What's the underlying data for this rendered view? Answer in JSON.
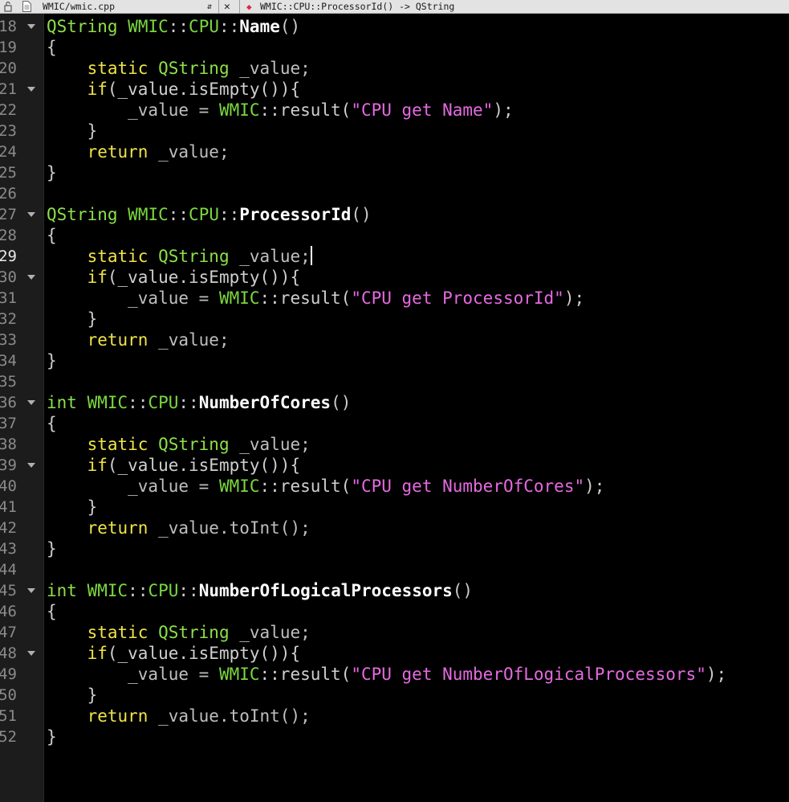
{
  "toolbar": {
    "file_name": "WMIC/wmic.cpp",
    "file_sort_glyph": "⇵",
    "close_glyph": "✕",
    "symbol_glyph": "◆",
    "symbol_name": "WMIC::CPU::ProcessorId() -> QString"
  },
  "editor": {
    "current_line": 29,
    "fold_lines": [
      18,
      21,
      27,
      30,
      36,
      39,
      45,
      48
    ],
    "lines": [
      {
        "n": "18",
        "t": [
          [
            "QString",
            "ty"
          ],
          [
            " ",
            "pn"
          ],
          [
            "WMIC",
            "ns"
          ],
          [
            "::",
            "pn"
          ],
          [
            "CPU",
            "ns"
          ],
          [
            "::",
            "pn"
          ],
          [
            "Name",
            "fn"
          ],
          [
            "()",
            "pn"
          ]
        ]
      },
      {
        "n": "19",
        "t": [
          [
            "{",
            "pn"
          ]
        ]
      },
      {
        "n": "20",
        "t": [
          [
            "    ",
            "pn"
          ],
          [
            "static",
            "kw"
          ],
          [
            " ",
            "pn"
          ],
          [
            "QString",
            "ty"
          ],
          [
            " _value;",
            "vr"
          ]
        ]
      },
      {
        "n": "21",
        "t": [
          [
            "    ",
            "pn"
          ],
          [
            "if",
            "kw"
          ],
          [
            "(_value.isEmpty()){",
            "mt"
          ]
        ]
      },
      {
        "n": "22",
        "t": [
          [
            "        _value = ",
            "vr"
          ],
          [
            "WMIC",
            "ns"
          ],
          [
            "::result(",
            "mt"
          ],
          [
            "\"CPU ",
            "st"
          ],
          [
            "get",
            "st"
          ],
          [
            " Name\"",
            "st"
          ],
          [
            ");",
            "pn"
          ]
        ]
      },
      {
        "n": "23",
        "t": [
          [
            "    }",
            "pn"
          ]
        ]
      },
      {
        "n": "24",
        "t": [
          [
            "    ",
            "pn"
          ],
          [
            "return",
            "kw"
          ],
          [
            " _value;",
            "vr"
          ]
        ]
      },
      {
        "n": "25",
        "t": [
          [
            "}",
            "pn"
          ]
        ]
      },
      {
        "n": "26",
        "t": []
      },
      {
        "n": "27",
        "t": [
          [
            "QString",
            "ty"
          ],
          [
            " ",
            "pn"
          ],
          [
            "WMIC",
            "ns"
          ],
          [
            "::",
            "pn"
          ],
          [
            "CPU",
            "ns"
          ],
          [
            "::",
            "pn"
          ],
          [
            "ProcessorId",
            "fn"
          ],
          [
            "()",
            "pn"
          ]
        ]
      },
      {
        "n": "28",
        "t": [
          [
            "{",
            "pn"
          ]
        ]
      },
      {
        "n": "29",
        "t": [
          [
            "    ",
            "pn"
          ],
          [
            "static",
            "kw"
          ],
          [
            " ",
            "pn"
          ],
          [
            "QString",
            "ty"
          ],
          [
            " _value;",
            "vr"
          ]
        ],
        "caret": true
      },
      {
        "n": "30",
        "t": [
          [
            "    ",
            "pn"
          ],
          [
            "if",
            "kw"
          ],
          [
            "(_value.isEmpty()){",
            "mt"
          ]
        ]
      },
      {
        "n": "31",
        "t": [
          [
            "        _value = ",
            "vr"
          ],
          [
            "WMIC",
            "ns"
          ],
          [
            "::result(",
            "mt"
          ],
          [
            "\"CPU ",
            "st"
          ],
          [
            "get",
            "st"
          ],
          [
            " ProcessorId\"",
            "st"
          ],
          [
            ");",
            "pn"
          ]
        ]
      },
      {
        "n": "32",
        "t": [
          [
            "    }",
            "pn"
          ]
        ]
      },
      {
        "n": "33",
        "t": [
          [
            "    ",
            "pn"
          ],
          [
            "return",
            "kw"
          ],
          [
            " _value;",
            "vr"
          ]
        ]
      },
      {
        "n": "34",
        "t": [
          [
            "}",
            "pn"
          ]
        ]
      },
      {
        "n": "35",
        "t": []
      },
      {
        "n": "36",
        "t": [
          [
            "int",
            "ty"
          ],
          [
            " ",
            "pn"
          ],
          [
            "WMIC",
            "ns"
          ],
          [
            "::",
            "pn"
          ],
          [
            "CPU",
            "ns"
          ],
          [
            "::",
            "pn"
          ],
          [
            "NumberOfCores",
            "fn"
          ],
          [
            "()",
            "pn"
          ]
        ]
      },
      {
        "n": "37",
        "t": [
          [
            "{",
            "pn"
          ]
        ]
      },
      {
        "n": "38",
        "t": [
          [
            "    ",
            "pn"
          ],
          [
            "static",
            "kw"
          ],
          [
            " ",
            "pn"
          ],
          [
            "QString",
            "ty"
          ],
          [
            " _value;",
            "vr"
          ]
        ]
      },
      {
        "n": "39",
        "t": [
          [
            "    ",
            "pn"
          ],
          [
            "if",
            "kw"
          ],
          [
            "(_value.isEmpty()){",
            "mt"
          ]
        ]
      },
      {
        "n": "40",
        "t": [
          [
            "        _value = ",
            "vr"
          ],
          [
            "WMIC",
            "ns"
          ],
          [
            "::result(",
            "mt"
          ],
          [
            "\"CPU ",
            "st"
          ],
          [
            "get",
            "st"
          ],
          [
            " NumberOfCores\"",
            "st"
          ],
          [
            ");",
            "pn"
          ]
        ]
      },
      {
        "n": "41",
        "t": [
          [
            "    }",
            "pn"
          ]
        ]
      },
      {
        "n": "42",
        "t": [
          [
            "    ",
            "pn"
          ],
          [
            "return",
            "kw"
          ],
          [
            " _value.toInt();",
            "vr"
          ]
        ]
      },
      {
        "n": "43",
        "t": [
          [
            "}",
            "pn"
          ]
        ]
      },
      {
        "n": "44",
        "t": []
      },
      {
        "n": "45",
        "t": [
          [
            "int",
            "ty"
          ],
          [
            " ",
            "pn"
          ],
          [
            "WMIC",
            "ns"
          ],
          [
            "::",
            "pn"
          ],
          [
            "CPU",
            "ns"
          ],
          [
            "::",
            "pn"
          ],
          [
            "NumberOfLogicalProcessors",
            "fn"
          ],
          [
            "()",
            "pn"
          ]
        ]
      },
      {
        "n": "46",
        "t": [
          [
            "{",
            "pn"
          ]
        ]
      },
      {
        "n": "47",
        "t": [
          [
            "    ",
            "pn"
          ],
          [
            "static",
            "kw"
          ],
          [
            " ",
            "pn"
          ],
          [
            "QString",
            "ty"
          ],
          [
            " _value;",
            "vr"
          ]
        ]
      },
      {
        "n": "48",
        "t": [
          [
            "    ",
            "pn"
          ],
          [
            "if",
            "kw"
          ],
          [
            "(_value.isEmpty()){",
            "mt"
          ]
        ]
      },
      {
        "n": "49",
        "t": [
          [
            "        _value = ",
            "vr"
          ],
          [
            "WMIC",
            "ns"
          ],
          [
            "::result(",
            "mt"
          ],
          [
            "\"CPU ",
            "st"
          ],
          [
            "get",
            "st"
          ],
          [
            " NumberOfLogicalProcessors\"",
            "st"
          ],
          [
            ");",
            "pn"
          ]
        ]
      },
      {
        "n": "50",
        "t": [
          [
            "    }",
            "pn"
          ]
        ]
      },
      {
        "n": "51",
        "t": [
          [
            "    ",
            "pn"
          ],
          [
            "return",
            "kw"
          ],
          [
            " _value.toInt();",
            "vr"
          ]
        ]
      },
      {
        "n": "52",
        "t": [
          [
            "}",
            "pn"
          ]
        ]
      }
    ]
  }
}
